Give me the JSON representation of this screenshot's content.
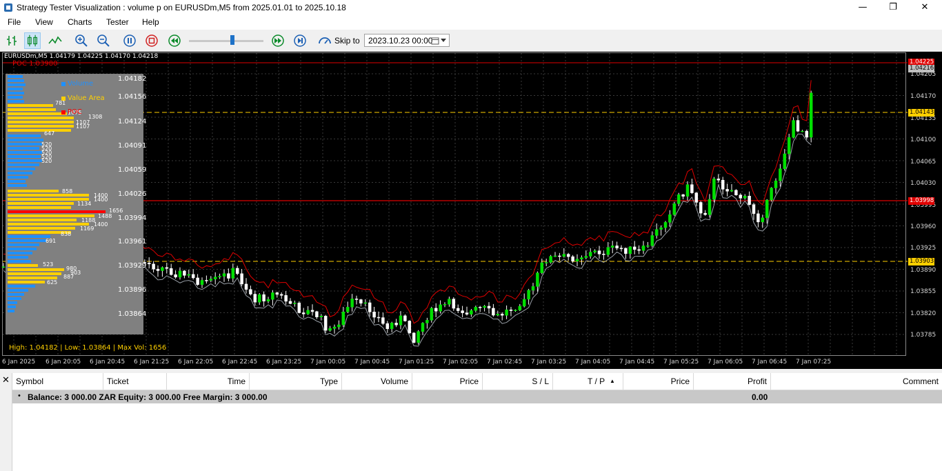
{
  "window": {
    "title": "Strategy Tester Visualization : volume p on EURUSDm,M5 from 2025.01.01 to 2025.10.18",
    "minimize": "—",
    "maximize": "❐",
    "close": "✕"
  },
  "menu": [
    "File",
    "View",
    "Charts",
    "Tester",
    "Help"
  ],
  "toolbar": {
    "skip_label": "Skip to",
    "skip_date": "2023.10.23 00:00"
  },
  "chart": {
    "symbol_info": "EURUSDm,M5  1.04179 1.04225 1.04170 1.04218",
    "poc_label": "POC 1.03980",
    "y_labels": [
      "1.04205",
      "1.04170",
      "1.04135",
      "1.04100",
      "1.04065",
      "1.04030",
      "1.03995",
      "1.03960",
      "1.03925",
      "1.03890",
      "1.03855",
      "1.03820",
      "1.03785"
    ],
    "price_tags": [
      {
        "text": "1.04225",
        "bg": "#e00000",
        "fg": "#ffffff"
      },
      {
        "text": "1.04216",
        "bg": "#c0c0c0",
        "fg": "#000000"
      },
      {
        "text": "1.04143",
        "bg": "#ffd000",
        "fg": "#000000"
      },
      {
        "text": "1.03998",
        "bg": "#e00000",
        "fg": "#ffffff"
      },
      {
        "text": "1.03903",
        "bg": "#ffd000",
        "fg": "#000000"
      }
    ],
    "x_labels": [
      "6 Jan 2025",
      "6 Jan 20:05",
      "6 Jan 20:45",
      "6 Jan 21:25",
      "6 Jan 22:05",
      "6 Jan 22:45",
      "6 Jan 23:25",
      "7 Jan 00:05",
      "7 Jan 00:45",
      "7 Jan 01:25",
      "7 Jan 02:05",
      "7 Jan 02:45",
      "7 Jan 03:25",
      "7 Jan 04:05",
      "7 Jan 04:45",
      "7 Jan 05:25",
      "7 Jan 06:05",
      "7 Jan 06:45",
      "7 Jan 07:25"
    ]
  },
  "volume_profile": {
    "levels": [
      "1.04182",
      "1.04156",
      "1.04124",
      "1.04091",
      "1.04059",
      "1.04026",
      "1.03994",
      "1.03961",
      "1.03929",
      "1.03896",
      "1.03864"
    ],
    "legend": {
      "volume": "Volume",
      "value_area": "Value Area",
      "poc": "POC"
    },
    "bar_labels": [
      "781",
      "1075",
      "1308",
      "1107",
      "1107",
      "647",
      "520",
      "520",
      "520",
      "520",
      "520",
      "858",
      "1400",
      "1400",
      "1134",
      "1656",
      "1488",
      "1188",
      "1400",
      "1169",
      "838",
      "691",
      "523",
      "980",
      "903",
      "887",
      "625"
    ],
    "stats": "High: 1.04182 | Low: 1.03864 | Max Vol: 1656",
    "colors": {
      "volume": "#1e90ff",
      "value_area": "#ffd000",
      "poc": "#ff0000"
    }
  },
  "table": {
    "columns": [
      "Symbol",
      "Ticket",
      "Time",
      "Type",
      "Volume",
      "Price",
      "S / L",
      "T / P",
      "Price",
      "Profit",
      "Comment"
    ],
    "sort_arrow": "▲",
    "balance_text": "Balance: 3 000.00 ZAR  Equity: 3 000.00  Free Margin: 3 000.00",
    "profit": "0.00",
    "bullet": "•"
  },
  "panel": {
    "close": "✕"
  }
}
